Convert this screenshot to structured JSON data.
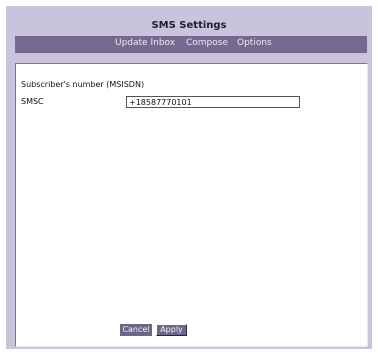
{
  "header": {
    "title": "SMS Settings"
  },
  "nav": {
    "items": [
      {
        "label": "Update Inbox"
      },
      {
        "label": "Compose"
      },
      {
        "label": "Options"
      }
    ]
  },
  "form": {
    "subscriber_label": "Subscriber's number (MSISDN)",
    "smsc_label": "SMSC",
    "smsc_value": "+18587770101"
  },
  "actions": {
    "cancel_label": "Cancel",
    "apply_label": "Apply"
  },
  "colors": {
    "frame": "#c9c3dc",
    "navbar": "#746a91",
    "button": "#6e6688"
  }
}
